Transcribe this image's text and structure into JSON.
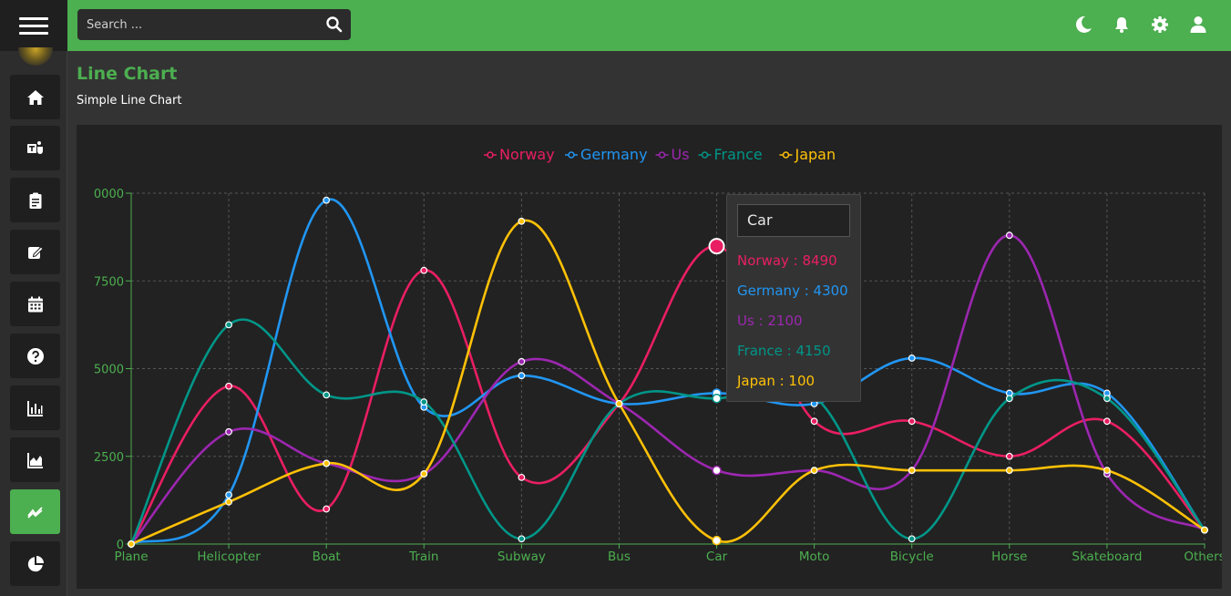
{
  "search": {
    "placeholder": "Search ..."
  },
  "sidebar": {
    "items": [
      {
        "icon": "home-icon"
      },
      {
        "icon": "teams-icon"
      },
      {
        "icon": "clipboard-icon"
      },
      {
        "icon": "edit-icon"
      },
      {
        "icon": "calendar-icon"
      },
      {
        "icon": "help-icon"
      },
      {
        "icon": "bar-chart-icon"
      },
      {
        "icon": "area-chart-icon"
      },
      {
        "icon": "line-chart-icon",
        "active": true
      },
      {
        "icon": "pie-chart-icon"
      }
    ]
  },
  "topbar": {
    "icons": [
      "moon-icon",
      "bell-icon",
      "gear-icon",
      "user-icon"
    ]
  },
  "page": {
    "title": "Line Chart",
    "subtitle": "Simple Line Chart"
  },
  "colors": {
    "accent": "#4caf50",
    "norway": "#e91e63",
    "germany": "#2196f3",
    "us": "#9c27b0",
    "france": "#009688",
    "japan": "#ffc107"
  },
  "chart_data": {
    "type": "line",
    "categories": [
      "Plane",
      "Helicopter",
      "Boat",
      "Train",
      "Subway",
      "Bus",
      "Car",
      "Moto",
      "Bicycle",
      "Horse",
      "Skateboard",
      "Others"
    ],
    "series": [
      {
        "name": "Norway",
        "color": "#e91e63",
        "values": [
          0,
          4500,
          1000,
          7800,
          1900,
          4000,
          8490,
          3500,
          3500,
          2500,
          3500,
          400
        ]
      },
      {
        "name": "Germany",
        "color": "#2196f3",
        "values": [
          0,
          1400,
          9800,
          3900,
          4800,
          4000,
          4300,
          4000,
          5300,
          4300,
          4300,
          400
        ]
      },
      {
        "name": "Us",
        "color": "#9c27b0",
        "values": [
          0,
          3200,
          2300,
          2000,
          5200,
          4000,
          2100,
          2100,
          2100,
          8800,
          2000,
          400
        ]
      },
      {
        "name": "France",
        "color": "#009688",
        "values": [
          0,
          6250,
          4250,
          4050,
          150,
          4000,
          4150,
          4200,
          150,
          4150,
          4150,
          400
        ]
      },
      {
        "name": "Japan",
        "color": "#ffc107",
        "values": [
          0,
          1200,
          2300,
          2000,
          9200,
          4000,
          100,
          2100,
          2100,
          2100,
          2100,
          400
        ]
      }
    ],
    "y_ticks": [
      "0",
      "2500",
      "5000",
      "7500",
      "0000"
    ],
    "ylim": [
      0,
      10000
    ],
    "grid": true,
    "legend": "top-center",
    "tooltip": {
      "title": "Car",
      "rows": [
        "Norway : 8490",
        "Germany : 4300",
        "Us : 2100",
        "France : 4150",
        "Japan : 100"
      ]
    }
  }
}
